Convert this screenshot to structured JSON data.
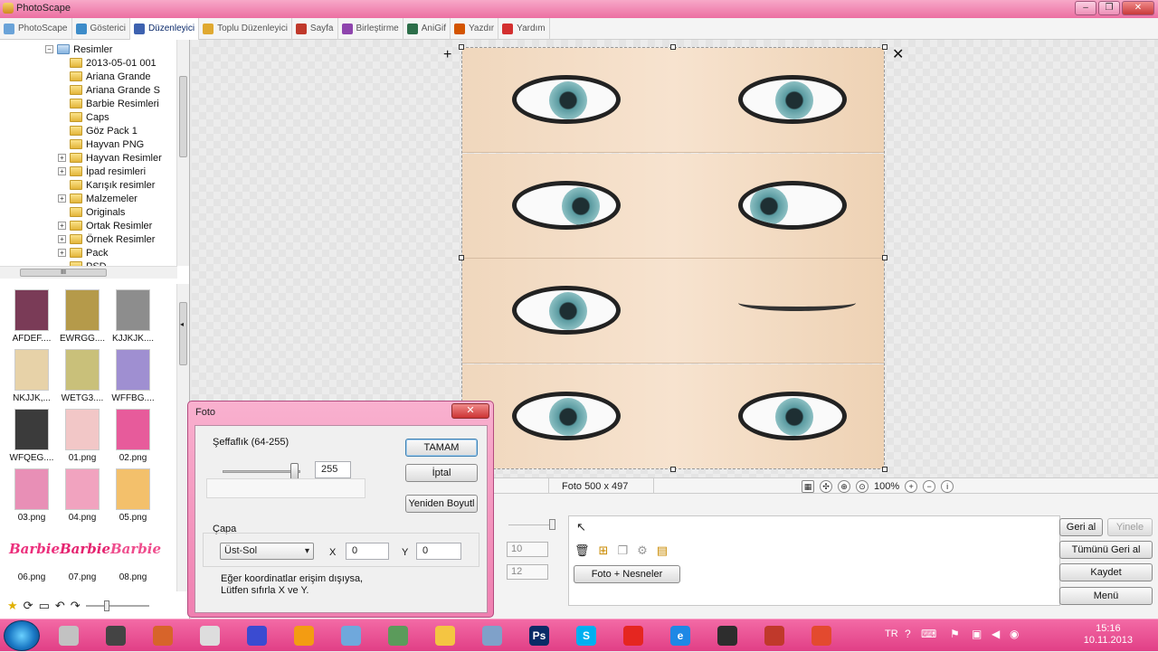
{
  "window": {
    "title": "PhotoScape"
  },
  "menu": {
    "items": [
      {
        "label": "PhotoScape",
        "icon": "photoscape-icon",
        "color": "#6aa3d8"
      },
      {
        "label": "Gösterici",
        "icon": "viewer-icon",
        "color": "#3d8cc9"
      },
      {
        "label": "Düzenleyici",
        "icon": "editor-icon",
        "color": "#3e62b0",
        "active": true
      },
      {
        "label": "Toplu Düzenleyici",
        "icon": "batch-editor-icon",
        "color": "#e0a930"
      },
      {
        "label": "Sayfa",
        "icon": "page-icon",
        "color": "#c0392b"
      },
      {
        "label": "Birleştirme",
        "icon": "combine-icon",
        "color": "#8e44ad"
      },
      {
        "label": "AniGif",
        "icon": "anigif-icon",
        "color": "#2c6e49"
      },
      {
        "label": "Yazdır",
        "icon": "print-icon",
        "color": "#d35400"
      },
      {
        "label": "Yardım",
        "icon": "help-icon",
        "color": "#d32f2f"
      }
    ]
  },
  "tree": {
    "root": "Resimler",
    "items": [
      {
        "label": "2013-05-01 001"
      },
      {
        "label": "Ariana Grande"
      },
      {
        "label": "Ariana Grande S"
      },
      {
        "label": "Barbie Resimleri"
      },
      {
        "label": "Caps"
      },
      {
        "label": "Göz Pack 1"
      },
      {
        "label": "Hayvan PNG"
      },
      {
        "label": "Hayvan Resimler",
        "expandable": true
      },
      {
        "label": "İpad resimleri",
        "expandable": true
      },
      {
        "label": "Karışık resimler"
      },
      {
        "label": "Malzemeler",
        "expandable": true
      },
      {
        "label": "Originals"
      },
      {
        "label": "Ortak Resimler",
        "expandable": true
      },
      {
        "label": "Örnek Resimler",
        "expandable": true
      },
      {
        "label": "Pack",
        "expandable": true
      },
      {
        "label": "PSD"
      }
    ],
    "hscroll_label": "III"
  },
  "thumbnails": [
    {
      "caption": "AFDEF....",
      "color": "#7a3b57"
    },
    {
      "caption": "EWRGG....",
      "color": "#b59a4a"
    },
    {
      "caption": "KJJKJK....",
      "color": "#8d8d8d"
    },
    {
      "caption": "NKJJK,...",
      "color": "#e7d2a8"
    },
    {
      "caption": "WETG3....",
      "color": "#c9c07a"
    },
    {
      "caption": "WFFBG....",
      "color": "#9f8fd1"
    },
    {
      "caption": "WFQEG....",
      "color": "#3b3b3b"
    },
    {
      "caption": "01.png",
      "color": "#f2c7c7"
    },
    {
      "caption": "02.png",
      "color": "#e75b9b"
    },
    {
      "caption": "03.png",
      "color": "#e88fb6"
    },
    {
      "caption": "04.png",
      "color": "#f1a3bf"
    },
    {
      "caption": "05.png",
      "color": "#f3c06b"
    },
    {
      "caption": "06.png",
      "color": "#ec2f7c",
      "text": "Barbie"
    },
    {
      "caption": "07.png",
      "color": "#e5226f",
      "text": "Barbie"
    },
    {
      "caption": "08.png",
      "color": "#ef4d8d",
      "text": "Barbie"
    }
  ],
  "status": {
    "photo_info": "Foto 500 x 497",
    "zoom": "100%"
  },
  "panel": {
    "numbers": [
      "10",
      "12"
    ],
    "objects_button": "Foto + Nesneler",
    "undo": "Geri al",
    "redo": "Yinele",
    "undo_all": "Tümünü Geri al",
    "save": "Kaydet",
    "menu": "Menü"
  },
  "dialog": {
    "title": "Foto",
    "close": "✕",
    "opacity_label": "Şeffaflık (64-255)",
    "opacity_value": "255",
    "opacity_level": 1.0,
    "ok": "TAMAM",
    "cancel": "İptal",
    "resize": "Yeniden Boyutl",
    "anchor_label": "Çapa",
    "anchor_value": "Üst-Sol",
    "x_label": "X",
    "x_value": "0",
    "y_label": "Y",
    "y_value": "0",
    "note_line1": "Eğer koordinatlar erişim dışıysa,",
    "note_line2": "Lütfen sıfırla X ve Y."
  },
  "taskbar": {
    "apps": [
      {
        "name": "start-button"
      },
      {
        "name": "paint-app-icon",
        "color": "#c2c2c2"
      },
      {
        "name": "media-app-icon",
        "color": "#444444"
      },
      {
        "name": "editor-app-icon",
        "color": "#d7642a"
      },
      {
        "name": "photoscape-app-icon",
        "color": "#dddddd"
      },
      {
        "name": "messenger-app-icon",
        "color": "#3a4bd1"
      },
      {
        "name": "player-app-icon",
        "color": "#f39c12"
      },
      {
        "name": "pen-app-icon",
        "color": "#6fa8dc"
      },
      {
        "name": "internet-app-icon",
        "color": "#5b9b5b"
      },
      {
        "name": "folder-app-icon",
        "color": "#f4c542"
      },
      {
        "name": "paint-palette-app-icon",
        "color": "#7fa1c9"
      },
      {
        "name": "photoshop-app-icon",
        "color": "#0a2b66",
        "text": "Ps"
      },
      {
        "name": "skype-app-icon",
        "color": "#00aff0",
        "text": "S"
      },
      {
        "name": "yandex-app-icon",
        "color": "#e52620"
      },
      {
        "name": "ie-app-icon",
        "color": "#1e88e5",
        "text": "e"
      },
      {
        "name": "film-app-icon",
        "color": "#2d2d2d"
      },
      {
        "name": "lyrics-app-icon",
        "color": "#c0392b"
      },
      {
        "name": "chrome-app-icon",
        "color": "#e34a2f"
      }
    ],
    "lang": "TR",
    "time": "15:16",
    "date": "10.11.2013"
  }
}
